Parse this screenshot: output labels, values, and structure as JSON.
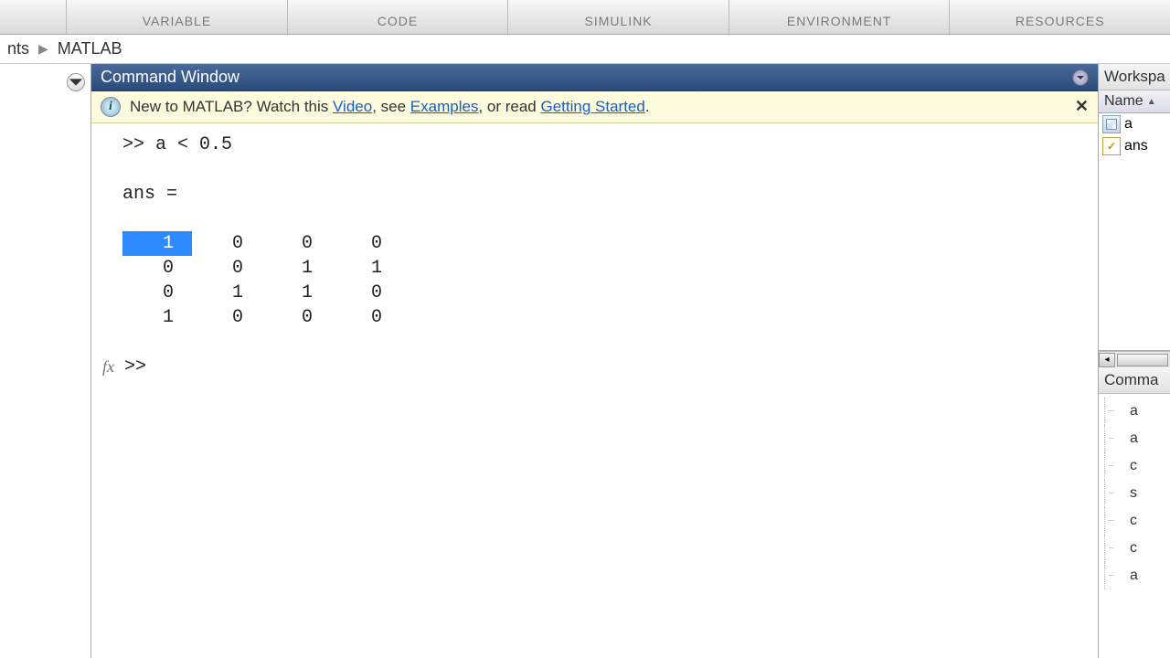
{
  "toolbar": {
    "groups": [
      "VARIABLE",
      "CODE",
      "SIMULINK",
      "ENVIRONMENT",
      "RESOURCES"
    ]
  },
  "breadcrumb": {
    "item1": "nts",
    "item2": "MATLAB"
  },
  "command_window": {
    "title": "Command Window",
    "banner": {
      "prefix": "New to MATLAB? Watch this ",
      "link1": "Video",
      "mid1": ", see ",
      "link2": "Examples",
      "mid2": ", or read ",
      "link3": "Getting Started",
      "suffix": "."
    },
    "input_line": ">> a < 0.5",
    "ans_label": "ans =",
    "matrix": [
      [
        "1",
        "0",
        "0",
        "0"
      ],
      [
        "0",
        "0",
        "1",
        "1"
      ],
      [
        "0",
        "1",
        "1",
        "0"
      ],
      [
        "1",
        "0",
        "0",
        "0"
      ]
    ],
    "prompt": ">> "
  },
  "workspace": {
    "title": "Workspa",
    "header": "Name",
    "vars": [
      {
        "name": "a",
        "type": "matrix"
      },
      {
        "name": "ans",
        "type": "logical"
      }
    ]
  },
  "history": {
    "title": "Comma",
    "items": [
      "a",
      "a",
      "c",
      "s",
      "c",
      "c",
      "a"
    ]
  }
}
